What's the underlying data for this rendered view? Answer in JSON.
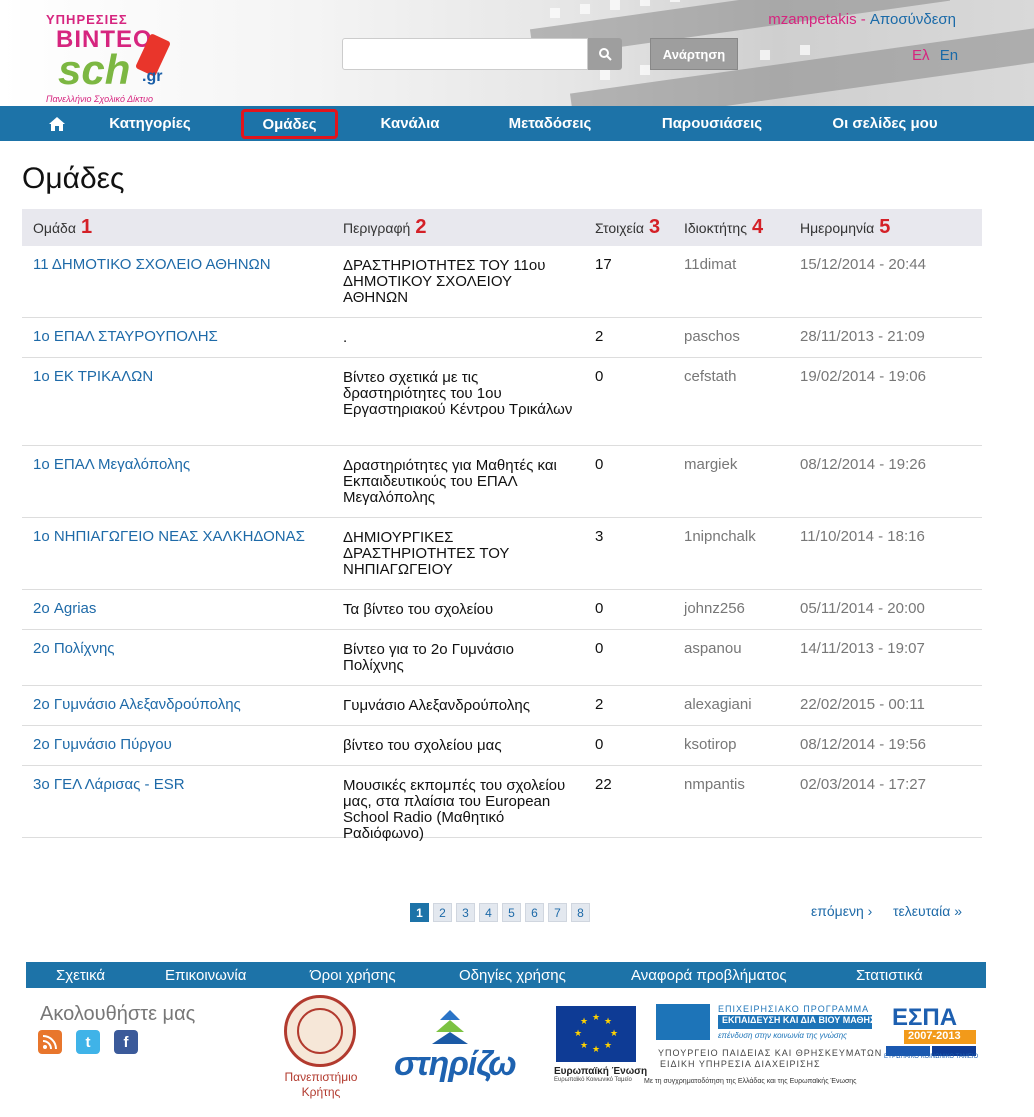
{
  "header": {
    "logo": {
      "line1": "ΥΠΗΡΕΣΙΕΣ",
      "line2": "ΒΙΝΤΕΟ",
      "line3": "sch",
      "line4": ".gr",
      "tagline": "Πανελλήνιο Σχολικό Δίκτυο"
    },
    "search": {
      "placeholder": ""
    },
    "upload_label": "Ανάρτηση",
    "username": "mzampetakis",
    "separator": " - ",
    "logout_label": "Αποσύνδεση",
    "lang_el": "Ελ",
    "lang_en": "En"
  },
  "nav": {
    "items": [
      {
        "label": "Κατηγορίες"
      },
      {
        "label": "Ομάδες"
      },
      {
        "label": "Κανάλια"
      },
      {
        "label": "Μεταδόσεις"
      },
      {
        "label": "Παρουσιάσεις"
      },
      {
        "label": "Οι σελίδες μου"
      }
    ],
    "active_index": 1
  },
  "page_title": "Ομάδες",
  "table": {
    "headers": [
      {
        "label": "Ομάδα",
        "num": "1"
      },
      {
        "label": "Περιγραφή",
        "num": "2"
      },
      {
        "label": "Στοιχεία",
        "num": "3"
      },
      {
        "label": "Ιδιοκτήτης",
        "num": "4"
      },
      {
        "label": "Ημερομηνία",
        "num": "5"
      }
    ],
    "rows": [
      {
        "group": "11 ΔΗΜΟΤΙΚΟ ΣΧΟΛΕΙΟ ΑΘΗΝΩΝ",
        "desc": "ΔΡΑΣΤΗΡΙΟΤΗΤΕΣ ΤΟΥ 11ου ΔΗΜΟΤΙΚΟΥ ΣΧΟΛΕΙΟΥ ΑΘΗΝΩΝ",
        "items": "17",
        "owner": "11dimat",
        "date": "15/12/2014 - 20:44"
      },
      {
        "group": "1ο ΕΠΑΛ ΣΤΑΥΡΟΥΠΟΛΗΣ",
        "desc": ".",
        "items": "2",
        "owner": "paschos",
        "date": "28/11/2013 - 21:09"
      },
      {
        "group": "1ο ΕΚ ΤΡΙΚΑΛΩΝ",
        "desc": "Βίντεο σχετικά με τις δραστηριότητες του 1ου Εργαστηριακού Κέντρου Τρικάλων",
        "items": "0",
        "owner": "cefstath",
        "date": "19/02/2014 - 19:06"
      },
      {
        "group": "1ο ΕΠΑΛ Μεγαλόπολης",
        "desc": "Δραστηριότητες για Μαθητές και Εκπαιδευτικούς του ΕΠΑΛ Μεγαλόπολης",
        "items": "0",
        "owner": "margiek",
        "date": "08/12/2014 - 19:26"
      },
      {
        "group": "1ο ΝΗΠΙΑΓΩΓΕΙΟ ΝΕΑΣ ΧΑΛΚΗΔΟΝΑΣ",
        "desc": "ΔΗΜΙΟΥΡΓΙΚΕΣ ΔΡΑΣΤΗΡΙΟΤΗΤΕΣ ΤΟΥ ΝΗΠΙΑΓΩΓΕΙΟΥ",
        "items": "3",
        "owner": "1nipnchalk",
        "date": "11/10/2014 - 18:16"
      },
      {
        "group": "2ο Agrias",
        "desc": "Τα βίντεο του σχολείου",
        "items": "0",
        "owner": "johnz256",
        "date": "05/11/2014 - 20:00"
      },
      {
        "group": "2ο Πολίχνης",
        "desc": "Βίντεο για το 2ο Γυμνάσιο Πολίχνης",
        "items": "0",
        "owner": "aspanou",
        "date": "14/11/2013 - 19:07"
      },
      {
        "group": "2ο Γυμνάσιο Αλεξανδρούπολης",
        "desc": "Γυμνάσιο Αλεξανδρούπολης",
        "items": "2",
        "owner": "alexagiani",
        "date": "22/02/2015 - 00:11"
      },
      {
        "group": "2ο Γυμνάσιο Πύργου",
        "desc": "βίντεο του σχολείου μας",
        "items": "0",
        "owner": "ksotirop",
        "date": "08/12/2014 - 19:56"
      },
      {
        "group": "3ο ΓΕΛ Λάρισας - ESR",
        "desc": "Μουσικές εκπομπές του σχολείου μας, στα πλαίσια του European School Radio (Μαθητικό Ραδιόφωνο)",
        "items": "22",
        "owner": "nmpantis",
        "date": "02/03/2014 - 17:27"
      }
    ]
  },
  "pagination": {
    "pages": [
      "1",
      "2",
      "3",
      "4",
      "5",
      "6",
      "7",
      "8"
    ],
    "current": "1",
    "next_label": "επόμενη ›",
    "last_label": "τελευταία »"
  },
  "footer": {
    "links": [
      "Σχετικά",
      "Επικοινωνία",
      "Όροι χρήσης",
      "Οδηγίες χρήσης",
      "Αναφορά προβλήματος",
      "Στατιστικά"
    ],
    "follow_label": "Ακολουθήστε μας",
    "uoc_label": "Πανεπιστήμιο Κρήτης",
    "stirizo": "στηρίζω",
    "eu_label": "Ευρωπαϊκή Ένωση",
    "eu_sub": "Ευρωπαϊκό Κοινωνικό Ταμείο",
    "edu_t1": "ΕΠΙΧΕΙΡΗΣΙΑΚΟ ΠΡΟΓΡΑΜΜΑ",
    "edu_t2": "ΕΚΠΑΙΔΕΥΣΗ ΚΑΙ ΔΙΑ ΒΙΟΥ ΜΑΘΗΣΗ",
    "edu_t3": "επένδυση στην κοινωνία της γνώσης",
    "edu_t4": "ΥΠΟΥΡΓΕΙΟ ΠΑΙΔΕΙΑΣ ΚΑΙ ΘΡΗΣΚΕΥΜΑΤΩΝ",
    "edu_t5": "ΕΙΔΙΚΗ ΥΠΗΡΕΣΙΑ ΔΙΑΧΕΙΡΙΣΗΣ",
    "edu_t6": "Με τη συγχρηματοδότηση της Ελλάδας και της Ευρωπαϊκής Ένωσης",
    "espa_title": "ΕΣΠΑ",
    "espa_years": "2007-2013",
    "espa_sub": "ΕΥΡΩΠΑΪΚΟ ΚΟΙΝΩΝΙΚΟ ΤΑΜΕΙΟ"
  },
  "colors": {
    "brand_blue": "#1d73a8",
    "link_blue": "#1e6aa8",
    "accent_pink": "#d6257f",
    "highlight_red": "#e3141c"
  }
}
